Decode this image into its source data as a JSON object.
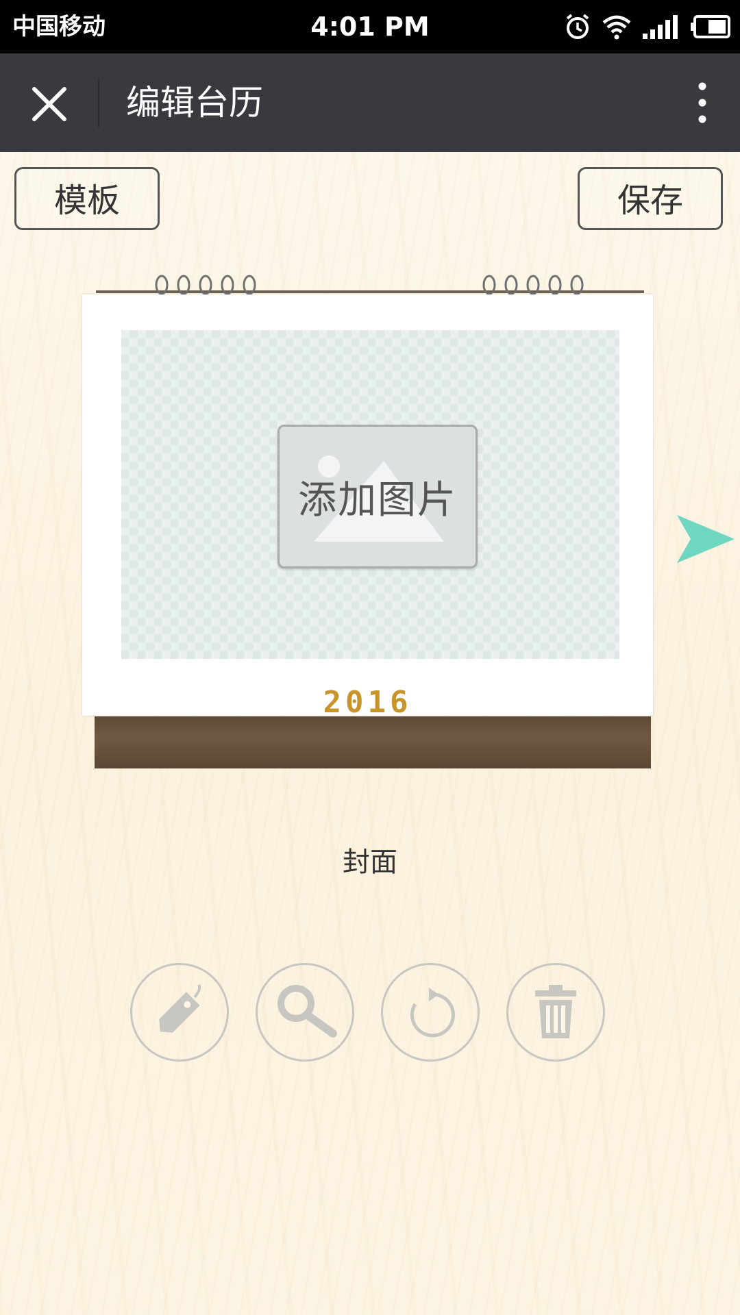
{
  "status_bar": {
    "carrier": "中国移动",
    "time": "4:01 PM",
    "icons": [
      "alarm-icon",
      "wifi-icon",
      "signal-icon",
      "battery-icon"
    ]
  },
  "title_bar": {
    "title": "编辑台历",
    "close_icon": "close-icon",
    "more_icon": "more-vertical-icon"
  },
  "toolbar": {
    "template_label": "模板",
    "save_label": "保存"
  },
  "calendar": {
    "add_photo_label": "添加图片",
    "year": "2016"
  },
  "page_label": "封面",
  "tools": [
    {
      "name": "tag-icon"
    },
    {
      "name": "search-icon"
    },
    {
      "name": "rotate-icon"
    },
    {
      "name": "trash-icon"
    }
  ],
  "colors": {
    "status_bar": "#000000",
    "title_bar": "#393a3f",
    "accent_arrow": "#6fd6bf",
    "year_text": "#c7952c",
    "tool_icon": "#c8c6c0"
  }
}
